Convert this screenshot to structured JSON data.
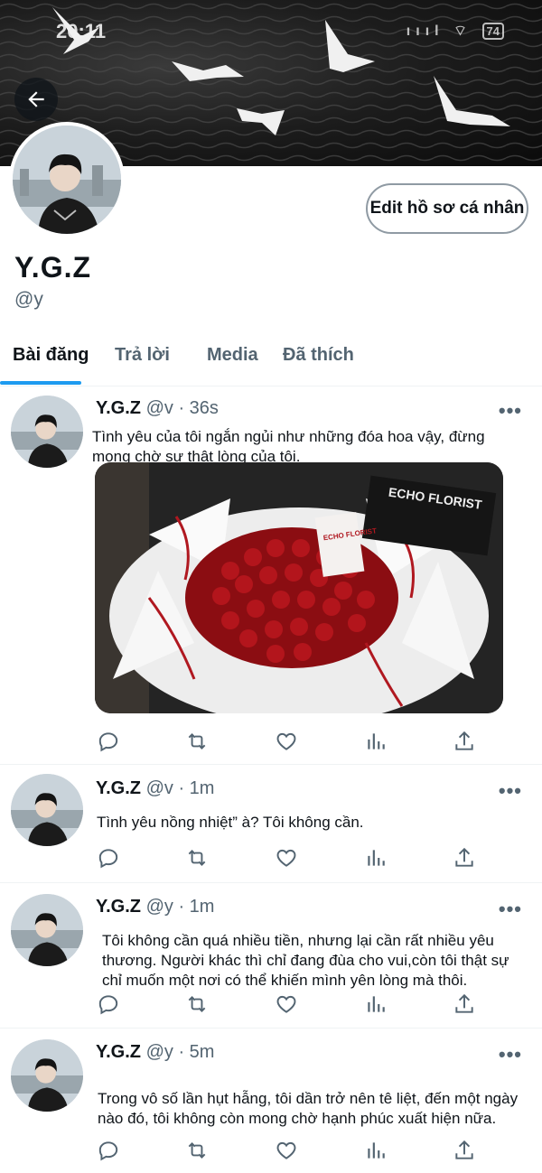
{
  "status_bar": {
    "time": "20:11",
    "signal": "ıııl",
    "wifi": "⌔",
    "battery": "74"
  },
  "profile": {
    "display_name": "Y.G.Z",
    "handle": "@y",
    "edit_label": "Edit hồ sơ cá nhân"
  },
  "tabs": [
    {
      "label": "Bài đăng",
      "active": true
    },
    {
      "label": "Trả lời",
      "active": false
    },
    {
      "label": "Media",
      "active": false
    },
    {
      "label": "Đã thích",
      "active": false
    }
  ],
  "tweets": [
    {
      "name": "Y.G.Z",
      "meta": "@v · 36s",
      "text": "Tình yêu của tôi ngắn ngủi như những đóa hoa vậy, đừng mong chờ sự thật lòng của tôi.",
      "media": {
        "card_text": "ECHO FLORIST",
        "tag_text": "ECHO FLORIST"
      }
    },
    {
      "name": "Y.G.Z",
      "meta": "@v · 1m",
      "text": "Tình yêu nồng nhiệt” à? Tôi không cần."
    },
    {
      "name": "Y.G.Z",
      "meta": "@y · 1m",
      "text": "Tôi không cần quá nhiều tiền, nhưng lại cần rất nhiều yêu thương. Người khác thì chỉ đang đùa cho vui,còn tôi thật sự chỉ muốn một nơi có thể khiến mình yên lòng mà thôi."
    },
    {
      "name": "Y.G.Z",
      "meta": "@y · 5m",
      "text": "Trong vô số lần hụt hẫng, tôi dần trở nên tê liệt, đến một ngày nào đó, tôi không còn mong chờ hạnh phúc xuất hiện nữa."
    }
  ],
  "more_glyph": "•••",
  "colors": {
    "accent": "#1d9bf0",
    "text": "#0f1419",
    "muted": "#536471",
    "divider": "#eff3f4"
  },
  "icons": [
    "arrow-left-icon",
    "reply-icon",
    "retweet-icon",
    "like-icon",
    "views-icon",
    "share-icon",
    "more-icon"
  ]
}
